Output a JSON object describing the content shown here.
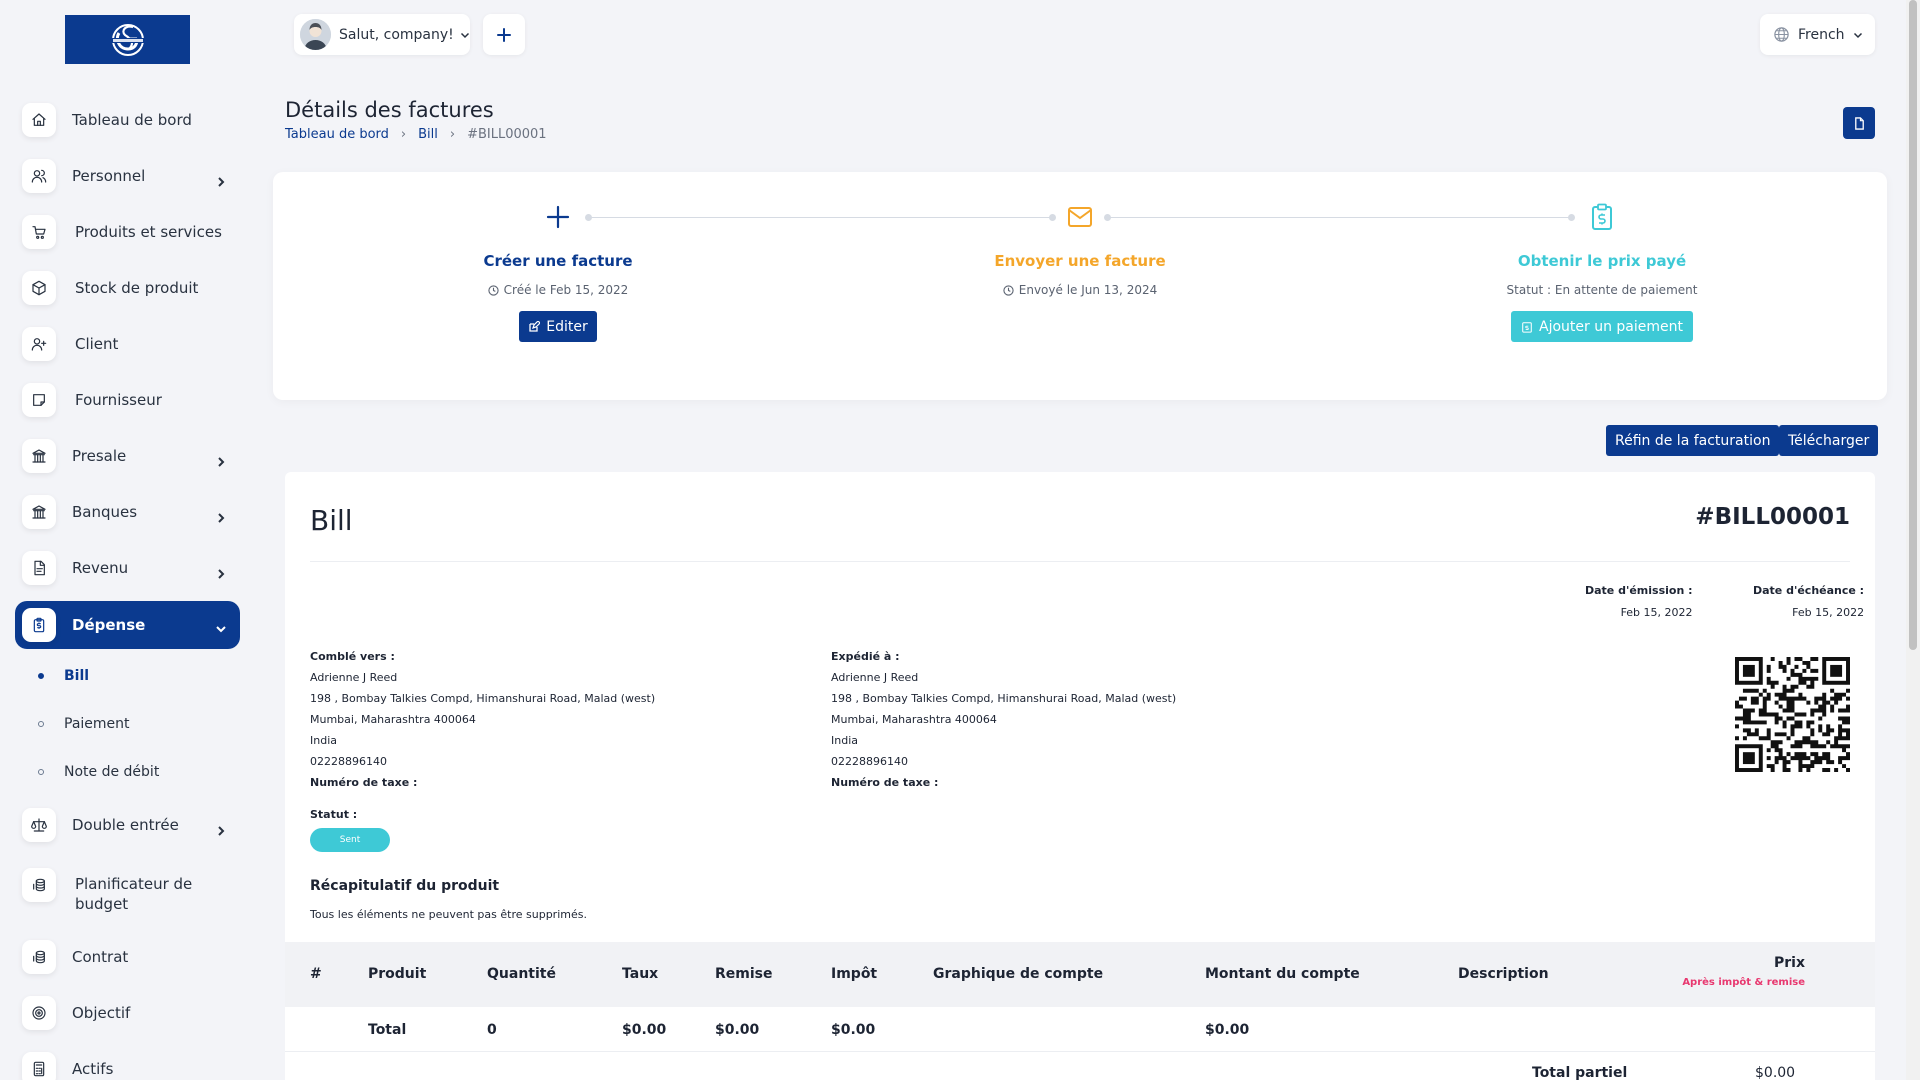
{
  "sidebar": {
    "items": [
      {
        "label": "Tableau de bord",
        "icon": "home-icon"
      },
      {
        "label": "Personnel",
        "icon": "users-icon"
      },
      {
        "label": "Produits et services",
        "icon": "cart-icon"
      },
      {
        "label": "Stock de produit",
        "icon": "box-icon"
      },
      {
        "label": "Client",
        "icon": "user-plus-icon"
      },
      {
        "label": "Fournisseur",
        "icon": "note-icon"
      },
      {
        "label": "Presale",
        "icon": "building-icon"
      },
      {
        "label": "Banques",
        "icon": "bank-icon"
      },
      {
        "label": "Revenu",
        "icon": "file-icon"
      },
      {
        "label": "Dépense",
        "icon": "clipboard-dollar-icon"
      },
      {
        "label": "Double entrée",
        "icon": "scale-icon"
      },
      {
        "label": "Planificateur de budget",
        "icon": "coins-icon"
      },
      {
        "label": "Contrat",
        "icon": "coins-icon"
      },
      {
        "label": "Objectif",
        "icon": "target-icon"
      },
      {
        "label": "Actifs",
        "icon": "calculator-icon"
      }
    ],
    "sub_items": [
      {
        "label": "Bill"
      },
      {
        "label": "Paiement"
      },
      {
        "label": "Note de débit"
      }
    ]
  },
  "topbar": {
    "greeting": "Salut, company!",
    "language": "French"
  },
  "page": {
    "title": "Détails des factures",
    "breadcrumb": [
      "Tableau de bord",
      "Bill",
      "#BILL00001"
    ]
  },
  "progress": {
    "steps": [
      {
        "title": "Créer une facture",
        "sub": "Créé le Feb 15, 2022",
        "button": "Editer",
        "color": "#0b3a8f"
      },
      {
        "title": "Envoyer une facture",
        "sub": "Envoyé le Jun 13, 2024",
        "color": "#f4a62a"
      },
      {
        "title": "Obtenir le prix payé",
        "sub": "Statut : En attente de paiement",
        "button": "Ajouter un paiement",
        "color": "#3ec9d6"
      }
    ]
  },
  "actions": {
    "recurring": "Réfin de la facturation",
    "download": "Télécharger"
  },
  "invoice": {
    "title": "Bill",
    "number": "#BILL00001",
    "issue_date_label": "Date d'émission :",
    "issue_date": "Feb 15, 2022",
    "due_date_label": "Date d'échéance :",
    "due_date": "Feb 15, 2022",
    "billed_to": {
      "heading": "Comblé vers :",
      "name": "Adrienne J Reed",
      "street": "198 , Bombay Talkies Compd, Himanshurai Road, Malad (west)",
      "city": "Mumbai, Maharashtra 400064",
      "country": "India",
      "phone": "02228896140",
      "tax": "Numéro de taxe :"
    },
    "shipped_to": {
      "heading": "Expédié à :",
      "name": "Adrienne J Reed",
      "street": "198 , Bombay Talkies Compd, Himanshurai Road, Malad (west)",
      "city": "Mumbai, Maharashtra 400064",
      "country": "India",
      "phone": "02228896140",
      "tax": "Numéro de taxe :"
    },
    "status_label": "Statut :",
    "status": "Sent",
    "summary_title": "Récapitulatif du produit",
    "summary_sub": "Tous les éléments ne peuvent pas être supprimés.",
    "columns": [
      "#",
      "Produit",
      "Quantité",
      "Taux",
      "Remise",
      "Impôt",
      "Graphique de compte",
      "Montant du compte",
      "Description"
    ],
    "price_header": "Prix",
    "price_sub": "Après impôt & remise",
    "total_row": {
      "label": "Total",
      "quantity": "0",
      "rate": "$0.00",
      "discount": "$0.00",
      "tax": "$0.00",
      "amount": "$0.00"
    },
    "subtotal_label": "Total partiel",
    "subtotal_value": "$0.00"
  }
}
